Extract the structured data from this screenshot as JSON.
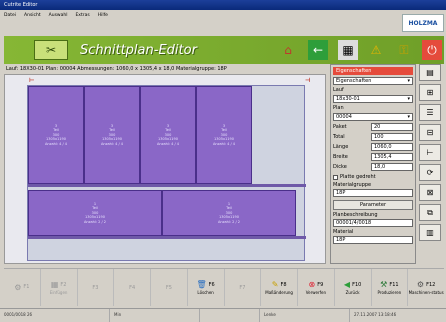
{
  "window": {
    "title": "Cutrite Editor"
  },
  "menu": [
    "Datei",
    "Ansicht",
    "Auswahl",
    "Extras",
    "Hilfe"
  ],
  "logo": "HOLZMA",
  "banner": {
    "title": "Schnittplan-Editor"
  },
  "toolbar": [
    "home-icon",
    "back-icon",
    "grid-icon",
    "warning-icon",
    "key-icon",
    "power-icon"
  ],
  "info": {
    "text": "Lauf: 18X30-01  Plan: 00004  Abmessungen: 1060,0 x 1305,4 x 18,0  Materialgruppe: 18P"
  },
  "panel": {
    "header": "Eigenschaften",
    "select1": "Eigenschaften",
    "lauf_label": "Lauf",
    "lauf_value": "18x30-01",
    "plan_label": "Plan",
    "plan_value": "00004",
    "fields": [
      {
        "label": "Paket",
        "value": "20"
      },
      {
        "label": "Total",
        "value": "100"
      },
      {
        "label": "Länge",
        "value": "1060,0"
      },
      {
        "label": "Breite",
        "value": "1305,4"
      },
      {
        "label": "Dicke",
        "value": "18,0"
      }
    ],
    "check_label": "Platte gedreht",
    "matgroup_label": "Materialgruppe",
    "matgroup_value": "18P",
    "param_button": "Parameter",
    "plan_desc_label": "Planbeschreibung",
    "plan_desc_value": "00001/4/0018",
    "material_label": "Material",
    "material_value": "18P"
  },
  "parts": [
    {
      "n": "3",
      "lines": [
        "Teil",
        "300",
        "1305x1190",
        "18x30-01",
        "Anzahl: 4 / 4"
      ]
    },
    {
      "n": "3",
      "lines": [
        "Teil",
        "300",
        "1305x1190",
        "18x30-01",
        "Anzahl: 4 / 4"
      ]
    },
    {
      "n": "3",
      "lines": [
        "Teil",
        "300",
        "1305x1190",
        "18x30-01",
        "Anzahl: 4 / 4"
      ]
    },
    {
      "n": "3",
      "lines": [
        "Teil",
        "300",
        "1305x1190",
        "18x30-01",
        "Anzahl: 4 / 4"
      ]
    },
    {
      "n": "1",
      "lines": [
        "Teil",
        "300",
        "1305x1190",
        "18x30-01",
        "Anzahl: 2 / 2"
      ]
    },
    {
      "n": "1",
      "lines": [
        "Teil",
        "300",
        "1305x1190",
        "18x30-01",
        "Anzahl: 2 / 2"
      ]
    }
  ],
  "fkeys": [
    {
      "key": "F1",
      "label": "",
      "icon": "puzzle-icon",
      "disabled": true
    },
    {
      "key": "F2",
      "label": "Einfügen",
      "icon": "table-icon",
      "disabled": true
    },
    {
      "key": "F3",
      "label": "",
      "icon": "",
      "disabled": true
    },
    {
      "key": "F4",
      "label": "",
      "icon": "",
      "disabled": true
    },
    {
      "key": "F5",
      "label": "",
      "icon": "",
      "disabled": true
    },
    {
      "key": "F6",
      "label": "Löschen",
      "icon": "trash-icon",
      "disabled": false
    },
    {
      "key": "F7",
      "label": "",
      "icon": "",
      "disabled": true
    },
    {
      "key": "F8",
      "label": "Maßänderung",
      "icon": "measure-icon",
      "disabled": false
    },
    {
      "key": "F9",
      "label": "Verwerfen",
      "icon": "cancel-icon",
      "disabled": false
    },
    {
      "key": "F10",
      "label": "Zurück",
      "icon": "back-icon",
      "disabled": false
    },
    {
      "key": "F11",
      "label": "Produzieren",
      "icon": "produce-icon",
      "disabled": false
    },
    {
      "key": "F12",
      "label": "Maschinen-status",
      "icon": "machine-icon",
      "disabled": false
    }
  ],
  "status": [
    "0001/0018 26",
    "Min",
    "",
    "Lenke",
    "27.11.2007 13:18:46"
  ]
}
